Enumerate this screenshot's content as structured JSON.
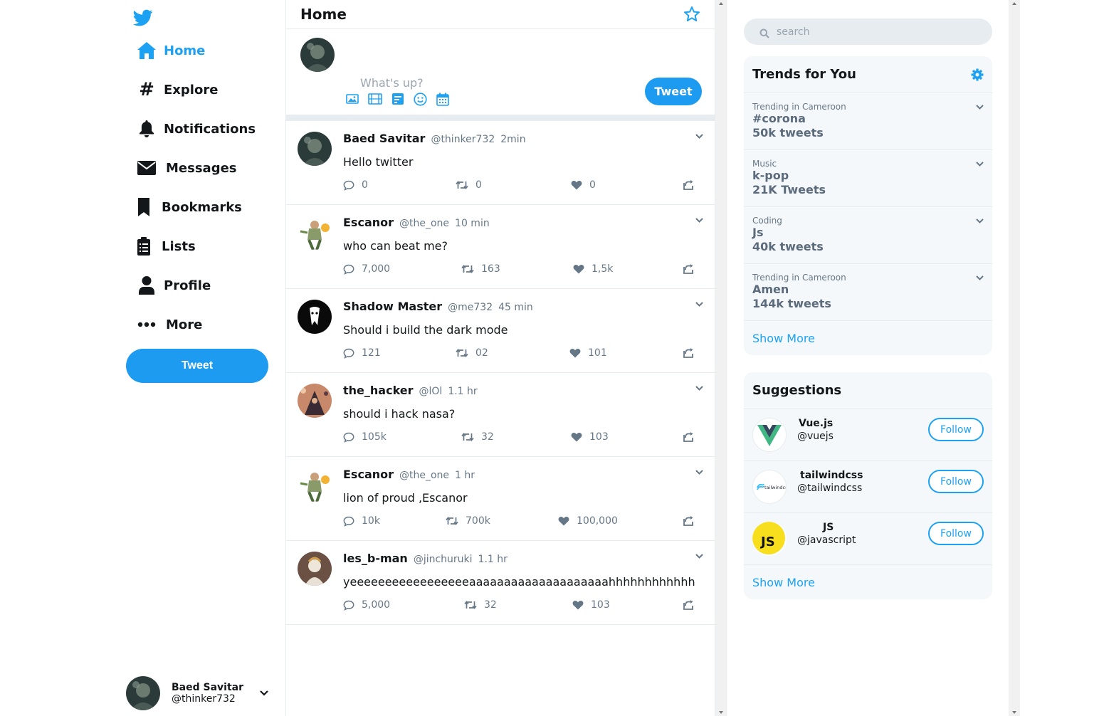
{
  "sidebar": {
    "nav": [
      {
        "label": "Home",
        "icon": "home-icon"
      },
      {
        "label": "Explore",
        "icon": "hashtag-icon"
      },
      {
        "label": "Notifications",
        "icon": "bell-icon"
      },
      {
        "label": "Messages",
        "icon": "envelope-icon"
      },
      {
        "label": "Bookmarks",
        "icon": "bookmark-icon"
      },
      {
        "label": "Lists",
        "icon": "clipboard-list-icon"
      },
      {
        "label": "Profile",
        "icon": "user-icon"
      },
      {
        "label": "More",
        "icon": "ellipsis-icon"
      }
    ],
    "tweet_label": "Tweet",
    "user": {
      "name": "Baed Savitar",
      "handle": "@thinker732"
    }
  },
  "feed": {
    "title": "Home",
    "composer_placeholder": "What's up?",
    "tweet_button": "Tweet",
    "tweets": [
      {
        "name": "Baed Savitar",
        "handle": "@thinker732",
        "time": "2min",
        "text": "Hello twitter",
        "replies": "0",
        "retweets": "0",
        "likes": "0"
      },
      {
        "name": "Escanor",
        "handle": "@the_one",
        "time": "10 min",
        "text": "who can beat me?",
        "replies": "7,000",
        "retweets": "163",
        "likes": "1,5k"
      },
      {
        "name": "Shadow Master",
        "handle": "@me732",
        "time": "45 min",
        "text": "Should i build the dark mode",
        "replies": "121",
        "retweets": "02",
        "likes": "101"
      },
      {
        "name": "the_hacker",
        "handle": "@lOl",
        "time": "1.1 hr",
        "text": "should i hack nasa?",
        "replies": "105k",
        "retweets": "32",
        "likes": "103"
      },
      {
        "name": "Escanor",
        "handle": "@the_one",
        "time": "1 hr",
        "text": "lion of proud ,Escanor",
        "replies": "10k",
        "retweets": "700k",
        "likes": "100,000"
      },
      {
        "name": "les_b-man",
        "handle": "@jinchuruki",
        "time": "1.1 hr",
        "text": "yeeeeeeeeeeeeeeeeeaaaaaaaaaaaaaaaaaaaahhhhhhhhhhhh",
        "replies": "5,000",
        "retweets": "32",
        "likes": "103"
      }
    ]
  },
  "right": {
    "search_placeholder": "search",
    "trends_title": "Trends for You",
    "trends": [
      {
        "category": "Trending in Cameroon",
        "tag": "#corona",
        "count": "50k tweets"
      },
      {
        "category": "Music",
        "tag": "k-pop",
        "count": "21K Tweets"
      },
      {
        "category": "Coding",
        "tag": "Js",
        "count": "40k tweets"
      },
      {
        "category": "Trending in Cameroon",
        "tag": "Amen",
        "count": "144k tweets"
      }
    ],
    "trends_show_more": "Show More",
    "suggestions_title": "Suggestions",
    "suggestions": [
      {
        "name": "Vue.js",
        "handle": "@vuejs",
        "follow": "Follow"
      },
      {
        "name": "tailwindcss",
        "handle": "@tailwindcss",
        "follow": "Follow",
        "logo_text": "tailwindcss"
      },
      {
        "name": "JS",
        "handle": "@javascript",
        "follow": "Follow",
        "logo_text": "JS"
      }
    ],
    "suggestions_show_more": "Show More"
  },
  "colors": {
    "accent": "#1da1f2",
    "button": "#1d9bf0",
    "panel": "#f5f8fa",
    "border": "#e6ecf0"
  }
}
